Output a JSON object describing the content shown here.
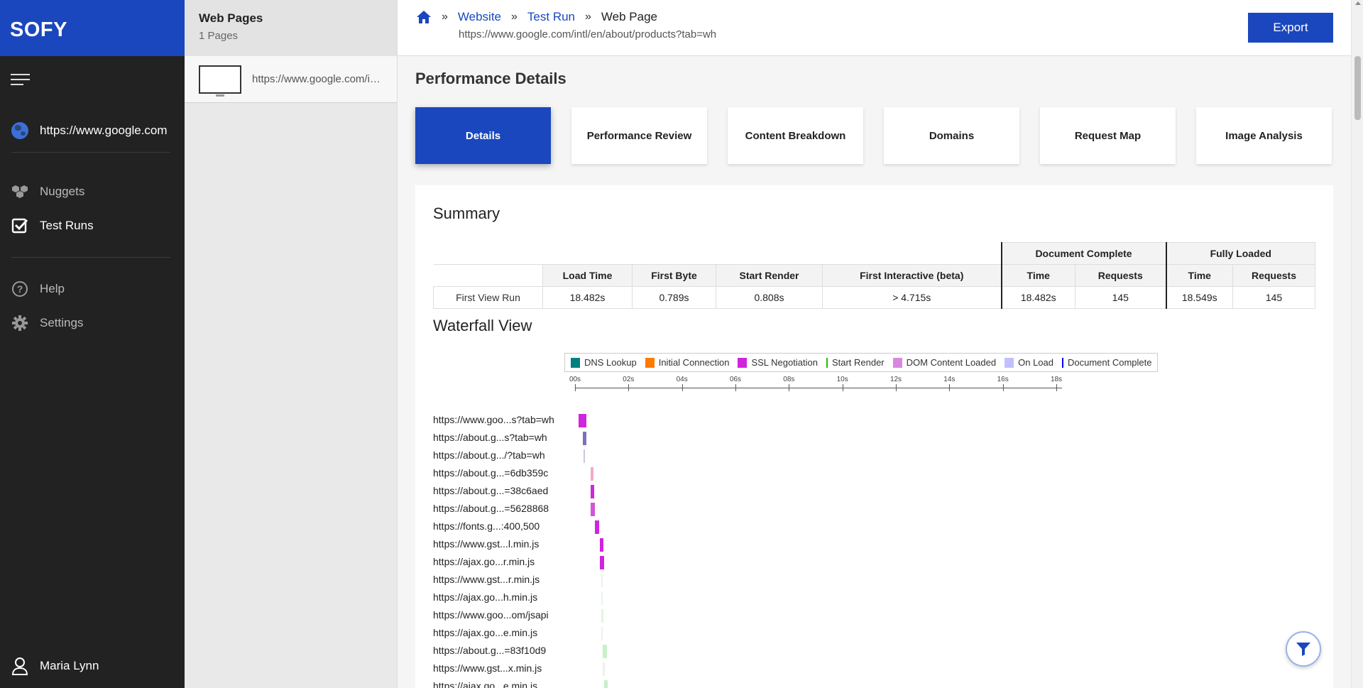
{
  "sidebar": {
    "brand": "SOFY",
    "site": "https://www.google.com",
    "nav": [
      {
        "label": "Nuggets",
        "icon": "cubes-icon"
      },
      {
        "label": "Test Runs",
        "icon": "checkbox-icon"
      },
      {
        "label": "Help",
        "icon": "question-circle-icon"
      },
      {
        "label": "Settings",
        "icon": "gear-icon"
      }
    ],
    "user": "Maria Lynn"
  },
  "pages_panel": {
    "title": "Web Pages",
    "count": "1 Pages",
    "items": [
      {
        "url": "https://www.google.com/intl/en/about/products?tab=wh"
      }
    ]
  },
  "header": {
    "crumbs": [
      "Website",
      "Test Run",
      "Web Page"
    ],
    "url": "https://www.google.com/intl/en/about/products?tab=wh",
    "export_label": "Export"
  },
  "main": {
    "title": "Performance Details",
    "tabs": [
      "Details",
      "Performance Review",
      "Content Breakdown",
      "Domains",
      "Request Map",
      "Image Analysis"
    ],
    "active_tab": "Details"
  },
  "summary": {
    "title": "Summary",
    "group_headers": {
      "document": "Document Complete",
      "fully": "Fully Loaded"
    },
    "columns": [
      "Load Time",
      "First Byte",
      "Start Render",
      "First Interactive (beta)",
      "Time",
      "Requests",
      "Time",
      "Requests"
    ],
    "row": {
      "label": "First View Run",
      "values": [
        "18.482s",
        "0.789s",
        "0.808s",
        "> 4.715s",
        "18.482s",
        "145",
        "18.549s",
        "145"
      ]
    }
  },
  "waterfall": {
    "title": "Waterfall View",
    "legend": [
      {
        "label": "DNS Lookup",
        "color": "#008080",
        "kind": "box"
      },
      {
        "label": "Initial Connection",
        "color": "#ff7b00",
        "kind": "box"
      },
      {
        "label": "SSL Negotiation",
        "color": "#cf25df",
        "kind": "box"
      },
      {
        "label": "Start Render",
        "color": "#28bc00",
        "kind": "line"
      },
      {
        "label": "DOM Content Loaded",
        "color": "#d888df",
        "kind": "box"
      },
      {
        "label": "On Load",
        "color": "#c0c0ff",
        "kind": "box"
      },
      {
        "label": "Document Complete",
        "color": "#0000ff",
        "kind": "line"
      }
    ],
    "axis_ticks": [
      "00s",
      "02s",
      "04s",
      "06s",
      "08s",
      "10s",
      "12s",
      "14s",
      "16s",
      "18s"
    ],
    "axis_max_s": 18,
    "rows": [
      {
        "label": "https://www.goo...s?tab=wh",
        "start": 0.0,
        "end": 0.28,
        "color": "#cf25df"
      },
      {
        "label": "https://about.g...s?tab=wh",
        "start": 0.15,
        "end": 0.28,
        "color": "#7d6fc0"
      },
      {
        "label": "https://about.g.../?tab=wh",
        "start": 0.18,
        "end": 0.24,
        "color": "#c9c9d9"
      },
      {
        "label": "https://about.g...=6db359c",
        "start": 0.45,
        "end": 0.55,
        "color": "#f5a9c9"
      },
      {
        "label": "https://about.g...=38c6aed",
        "start": 0.45,
        "end": 0.58,
        "color": "#cf25df"
      },
      {
        "label": "https://about.g...=5628868",
        "start": 0.45,
        "end": 0.6,
        "color": "#d355d8"
      },
      {
        "label": "https://fonts.g...:400,500",
        "start": 0.6,
        "end": 0.78,
        "color": "#cf25df"
      },
      {
        "label": "https://www.gst...l.min.js",
        "start": 0.8,
        "end": 0.93,
        "color": "#cf25df"
      },
      {
        "label": "https://ajax.go...r.min.js",
        "start": 0.8,
        "end": 0.95,
        "color": "#cf25df"
      },
      {
        "label": "https://www.gst...r.min.js",
        "start": 0.85,
        "end": 0.9,
        "color": "#e8f4e8"
      },
      {
        "label": "https://ajax.go...h.min.js",
        "start": 0.85,
        "end": 0.9,
        "color": "#e8f4e8"
      },
      {
        "label": "https://www.goo...om/jsapi",
        "start": 0.85,
        "end": 0.92,
        "color": "#e2f5e2"
      },
      {
        "label": "https://ajax.go...e.min.js",
        "start": 0.85,
        "end": 0.9,
        "color": "#e8f4e8"
      },
      {
        "label": "https://about.g...=83f10d9",
        "start": 0.9,
        "end": 1.05,
        "color": "#c9f0c9"
      },
      {
        "label": "https://www.gst...x.min.js",
        "start": 0.9,
        "end": 0.98,
        "color": "#e8f4e8"
      },
      {
        "label": "https://ajax.go...e.min.js",
        "start": 0.95,
        "end": 1.1,
        "color": "#c9f0c9"
      }
    ]
  }
}
